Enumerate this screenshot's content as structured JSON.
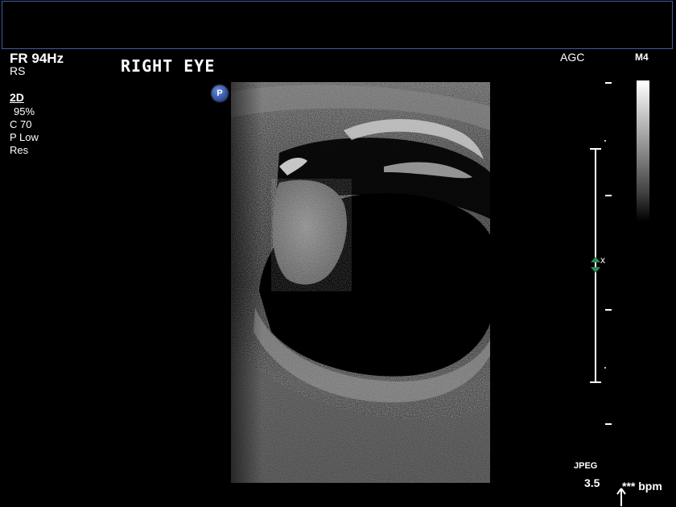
{
  "header": {
    "frame_rate": "FR 94Hz",
    "transducer": "RS",
    "title": "RIGHT EYE",
    "agc": "AGC",
    "map": "M4"
  },
  "settings": {
    "mode": "2D",
    "gain": "95%",
    "compress": "C 70",
    "power": "P Low",
    "res": "Res"
  },
  "probe_marker": "P",
  "footer": {
    "format": "JPEG",
    "frequency": "3.5",
    "bpm": "*** bpm"
  },
  "focus_marker": "x",
  "colors": {
    "topbar_border": "#3c5f9c",
    "focus_marker": "#2e8b57",
    "probe_marker": "#2c4a9a"
  }
}
